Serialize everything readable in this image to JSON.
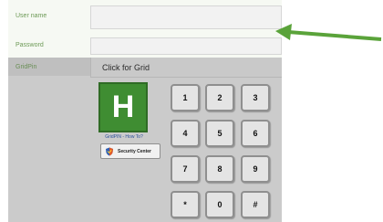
{
  "form": {
    "username_label": "User name",
    "password_label": "Password",
    "gridpin_label": "GridPin",
    "grid_button": "Click for Grid"
  },
  "gridpin": {
    "logo_letter": "H",
    "howto_link": "GridPIN - How To?",
    "security_center": "Security Center"
  },
  "keypad": {
    "keys": [
      "1",
      "2",
      "3",
      "4",
      "5",
      "6",
      "7",
      "8",
      "9",
      "*",
      "0",
      "#"
    ]
  },
  "colors": {
    "label_green": "#6d9a56",
    "logo_green": "#3f8d32",
    "arrow_green": "#5aa33a"
  }
}
